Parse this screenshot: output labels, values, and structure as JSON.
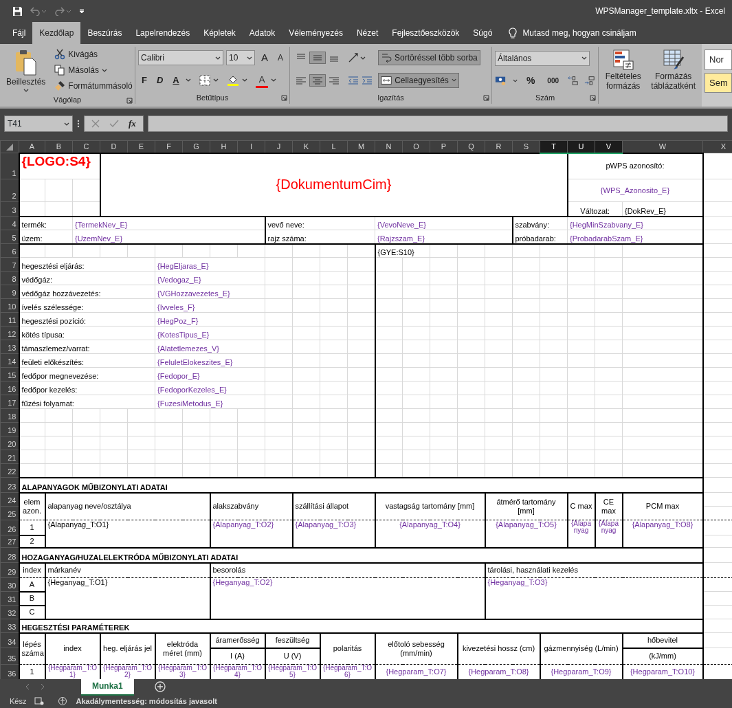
{
  "window": {
    "title": "WPSManager_template.xltx  -  Excel"
  },
  "ribbon_tabs": [
    {
      "label": "Fájl",
      "selected": false
    },
    {
      "label": "Kezdőlap",
      "selected": true
    },
    {
      "label": "Beszúrás",
      "selected": false
    },
    {
      "label": "Lapelrendezés",
      "selected": false
    },
    {
      "label": "Képletek",
      "selected": false
    },
    {
      "label": "Adatok",
      "selected": false
    },
    {
      "label": "Véleményezés",
      "selected": false
    },
    {
      "label": "Nézet",
      "selected": false
    },
    {
      "label": "Fejlesztőeszközök",
      "selected": false
    },
    {
      "label": "Súgó",
      "selected": false
    }
  ],
  "tell_me": "Mutasd meg, hogyan csináljam",
  "clipboard": {
    "paste": "Beillesztés",
    "cut": "Kivágás",
    "copy": "Másolás",
    "format_painter": "Formátummásoló",
    "group": "Vágólap"
  },
  "font": {
    "name": "Calibri",
    "size": "10",
    "grow": "A",
    "shrink": "A",
    "bold": "F",
    "italic": "D",
    "underline": "A",
    "font_color": "A",
    "group": "Betűtípus"
  },
  "alignment": {
    "vertical": [
      {
        "selected": false
      },
      {
        "selected": true
      },
      {
        "selected": false
      }
    ],
    "horizontal": [
      {
        "selected": false
      },
      {
        "selected": true
      },
      {
        "selected": false
      }
    ],
    "wrap_text": {
      "label": "Sortöréssel több sorba",
      "on": true
    },
    "merge": {
      "label": "Cellaegyesítés",
      "on": true
    },
    "group": "Igazítás"
  },
  "number": {
    "format": "Általános",
    "percent": "%",
    "thousands": "000",
    "group": "Szám"
  },
  "styles": {
    "conditional": "Feltételes formázás",
    "as_table": "Formázás táblázatként",
    "gallery": [
      {
        "label": "Nor",
        "color": "#ffffff"
      },
      {
        "label": "Sem",
        "color": "#ffeb9c"
      }
    ]
  },
  "formula_bar": {
    "name_box": "T41",
    "function_label": "fx"
  },
  "columns": [
    {
      "label": "A",
      "selected": false
    },
    {
      "label": "B",
      "selected": false
    },
    {
      "label": "C",
      "selected": false
    },
    {
      "label": "D",
      "selected": false
    },
    {
      "label": "E",
      "selected": false
    },
    {
      "label": "F",
      "selected": false
    },
    {
      "label": "G",
      "selected": false
    },
    {
      "label": "H",
      "selected": false
    },
    {
      "label": "I",
      "selected": false
    },
    {
      "label": "J",
      "selected": false
    },
    {
      "label": "K",
      "selected": false
    },
    {
      "label": "L",
      "selected": false
    },
    {
      "label": "M",
      "selected": false
    },
    {
      "label": "N",
      "selected": false
    },
    {
      "label": "O",
      "selected": false
    },
    {
      "label": "P",
      "selected": false
    },
    {
      "label": "Q",
      "selected": false
    },
    {
      "label": "R",
      "selected": false
    },
    {
      "label": "S",
      "selected": false
    },
    {
      "label": "T",
      "selected": true
    },
    {
      "label": "U",
      "selected": true
    },
    {
      "label": "V",
      "selected": true
    },
    {
      "label": "W",
      "selected": false
    },
    {
      "label": "X",
      "selected": false
    }
  ],
  "rows": [
    "1",
    "2",
    "3",
    "4",
    "5",
    "6",
    "7",
    "8",
    "9",
    "10",
    "11",
    "12",
    "13",
    "14",
    "15",
    "16",
    "17",
    "18",
    "19",
    "20",
    "21",
    "22",
    "23",
    "24",
    "25",
    "26",
    "27",
    "28",
    "29",
    "30",
    "31",
    "32",
    "33",
    "34",
    "35",
    "36"
  ],
  "cells": [
    {
      "kind": "logo",
      "text": "{LOGO:S4}"
    },
    {
      "kind": "title",
      "text": "{DokumentumCim}"
    },
    {
      "kind": "label",
      "text": "pWPS azonosító:"
    },
    {
      "kind": "field",
      "text": "{WPS_Azonosito_E}"
    },
    {
      "kind": "label",
      "text": "Változat:"
    },
    {
      "kind": "label",
      "text": "{DokRev_E}"
    },
    {
      "kind": "label",
      "text": "termék:"
    },
    {
      "kind": "field",
      "text": "{TermekNev_E}"
    },
    {
      "kind": "label",
      "text": "vevő neve:"
    },
    {
      "kind": "field",
      "text": "{VevoNeve_E}"
    },
    {
      "kind": "label",
      "text": "szabvány:"
    },
    {
      "kind": "field",
      "text": "{HegMinSzabvany_E}"
    },
    {
      "kind": "label",
      "text": "üzem:"
    },
    {
      "kind": "field",
      "text": "{UzemNev_E}"
    },
    {
      "kind": "label",
      "text": "rajz száma:"
    },
    {
      "kind": "field",
      "text": "{Rajzszam_E}"
    },
    {
      "kind": "label",
      "text": "próbadarab:"
    },
    {
      "kind": "field",
      "text": "{ProbadarabSzam_E}"
    },
    {
      "kind": "label",
      "text": "{GYE:S10}"
    },
    {
      "kind": "label",
      "text": "hegesztési eljárás:"
    },
    {
      "kind": "field",
      "text": "{HegEljaras_E}"
    },
    {
      "kind": "label",
      "text": "védőgáz:"
    },
    {
      "kind": "field",
      "text": "{Vedogaz_E}"
    },
    {
      "kind": "label",
      "text": "védőgáz hozzávezetés:"
    },
    {
      "kind": "field",
      "text": "{VGHozzavezetes_E}"
    },
    {
      "kind": "label",
      "text": "ívelés szélessége:"
    },
    {
      "kind": "field",
      "text": "{Ivveles_F}"
    },
    {
      "kind": "label",
      "text": "hegesztési pozíció:"
    },
    {
      "kind": "field",
      "text": "{HegPoz_F}"
    },
    {
      "kind": "label",
      "text": "kötés típusa:"
    },
    {
      "kind": "field",
      "text": "{KotesTipus_E}"
    },
    {
      "kind": "label",
      "text": "támaszlemez/varrat:"
    },
    {
      "kind": "field",
      "text": "{Alatetlemezes_V}"
    },
    {
      "kind": "label",
      "text": "feületi előkészítés:"
    },
    {
      "kind": "field",
      "text": "{FeluletElokeszites_E}"
    },
    {
      "kind": "label",
      "text": "fedőpor megnevezése:"
    },
    {
      "kind": "field",
      "text": "{Fedopor_E}"
    },
    {
      "kind": "label",
      "text": "fedőpor kezelés:"
    },
    {
      "kind": "field",
      "text": "{FedoporKezeles_E}"
    },
    {
      "kind": "label",
      "text": "fűzési folyamat:"
    },
    {
      "kind": "field",
      "text": "{FuzesiMetodus_E}"
    },
    {
      "kind": "section",
      "text": "ALAPANYAGOK MŰBIZONYLATI ADATAI"
    },
    {
      "kind": "label",
      "text": "elem azon."
    },
    {
      "kind": "label",
      "text": "alapanyag neve/osztálya"
    },
    {
      "kind": "label",
      "text": "alakszabvány"
    },
    {
      "kind": "label",
      "text": "szállítási állapot"
    },
    {
      "kind": "label",
      "text": "vastagság tartomány [mm]"
    },
    {
      "kind": "label",
      "text": "átmérő tartomány [mm]"
    },
    {
      "kind": "label",
      "text": "C max"
    },
    {
      "kind": "label",
      "text": "CE max"
    },
    {
      "kind": "label",
      "text": "PCM max"
    },
    {
      "kind": "label",
      "text": "1"
    },
    {
      "kind": "label",
      "text": "{Alapanyag_T:O1}"
    },
    {
      "kind": "field",
      "text": "{Alapanyag_T:O2}"
    },
    {
      "kind": "field",
      "text": "{Alapanyag_T:O3}"
    },
    {
      "kind": "field",
      "text": "{Alapanyag_T:O4}"
    },
    {
      "kind": "field",
      "text": "{Alapanyag_T:O5}"
    },
    {
      "kind": "field",
      "text": "{Alapanyag"
    },
    {
      "kind": "field",
      "text": "{Alapanyag"
    },
    {
      "kind": "field",
      "text": "{Alapanyag_T:O8}"
    },
    {
      "kind": "label",
      "text": "2"
    },
    {
      "kind": "section",
      "text": "HOZAGANYAG/HUZALELEKTRÓDA MŰBIZONYLATI ADATAI"
    },
    {
      "kind": "label",
      "text": "index"
    },
    {
      "kind": "label",
      "text": "márkanév"
    },
    {
      "kind": "label",
      "text": "besorolás"
    },
    {
      "kind": "label",
      "text": "tárolási, használati kezelés"
    },
    {
      "kind": "label",
      "text": "A"
    },
    {
      "kind": "label",
      "text": "{Heganyag_T:O1}"
    },
    {
      "kind": "field",
      "text": "{Heganyag_T:O2}"
    },
    {
      "kind": "field",
      "text": "{Heganyag_T:O3}"
    },
    {
      "kind": "label",
      "text": "B"
    },
    {
      "kind": "label",
      "text": "C"
    },
    {
      "kind": "section",
      "text": "HEGESZTÉSI PARAMÉTEREK"
    },
    {
      "kind": "label",
      "text": "lépés száma"
    },
    {
      "kind": "label",
      "text": "index"
    },
    {
      "kind": "label",
      "text": "heg. eljárás jel"
    },
    {
      "kind": "label",
      "text": "elektróda méret (mm)"
    },
    {
      "kind": "label",
      "text": "áramerősség"
    },
    {
      "kind": "label",
      "text": "feszültség"
    },
    {
      "kind": "label",
      "text": "polaritás"
    },
    {
      "kind": "label",
      "text": "előtoló sebesség (mm/min)"
    },
    {
      "kind": "label",
      "text": "kivezetési hossz (cm)"
    },
    {
      "kind": "label",
      "text": "gázmennyiség (L/min)"
    },
    {
      "kind": "label",
      "text": "hőbevitel"
    },
    {
      "kind": "label",
      "text": "I (A)"
    },
    {
      "kind": "label",
      "text": "U (V)"
    },
    {
      "kind": "label",
      "text": "(kJ/mm)"
    },
    {
      "kind": "label",
      "text": "1"
    },
    {
      "kind": "field",
      "text": "{Hegparam_T:O1}"
    },
    {
      "kind": "field",
      "text": "{Hegparam_T:O2}"
    },
    {
      "kind": "field",
      "text": "{Hegparam_T:O3}"
    },
    {
      "kind": "field",
      "text": "{Hegparam_T:O4}"
    },
    {
      "kind": "field",
      "text": "{Hegparam_T:O5}"
    },
    {
      "kind": "field",
      "text": "{Hegparam_T:O6}"
    },
    {
      "kind": "field",
      "text": "{Hegparam_T:O7}"
    },
    {
      "kind": "field",
      "text": "{Hegparam_T:O8}"
    },
    {
      "kind": "field",
      "text": "{Hegparam_T:O9}"
    },
    {
      "kind": "field",
      "text": "{Hegparam_T:O10}"
    }
  ],
  "sheet_tabs": [
    {
      "label": "Munka1",
      "selected": true
    }
  ],
  "status_bar": {
    "ready": "Kész",
    "accessibility": "Akadálymentesség: módosítás javasolt"
  }
}
